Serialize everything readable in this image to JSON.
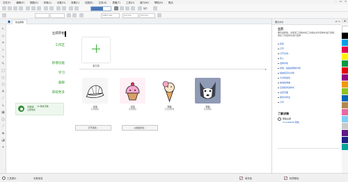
{
  "menubar": {
    "items": [
      "文件(F)",
      "编辑(E)",
      "视图(V)",
      "布局(L)",
      "对象(O)",
      "效果(C)",
      "位图(B)",
      "文本(X)",
      "表格(T)",
      "工具(O)",
      "窗口(W)",
      "帮助(H)",
      "购买"
    ],
    "controls": {
      "minimize": "–",
      "restore": "▭",
      "close": "×"
    }
  },
  "toolbar": {
    "snap_label": "贴齐",
    "field_x": "0.001 mm",
    "field_w1": "5.0 mm",
    "field_w2": "5.0 mm",
    "field_unit": "mm"
  },
  "document_tab": {
    "label": "欢迎屏幕"
  },
  "welcome": {
    "nav": {
      "items": [
        "立即开始",
        "工作区",
        "新增功能",
        "学习",
        "画廊",
        "获取更多"
      ],
      "active_index": 0
    },
    "promo": {
      "line1": "试用版",
      "line2": "立即购买",
      "line3": "16 剩余天数"
    },
    "new_document": {
      "label": "新文档"
    },
    "templates": [
      {
        "name": "试用",
        "sub": "使用模板"
      },
      {
        "name": "试用",
        "sub": "使用模板"
      },
      {
        "name": "样板",
        "sub": "已使用模板"
      },
      {
        "name": "样板",
        "sub": "使用模板"
      }
    ],
    "buttons": {
      "open_other": "打开其他...",
      "templates_btn": "从模板新建..."
    }
  },
  "right_panel": {
    "title": "提示(N)",
    "section1_title": "主页",
    "section1_text": "要获得帮助，请使用工具箱中的工具或在文件菜单中进行选择，或在下列选项中进行选择：",
    "links": [
      "新建",
      "打开",
      "打开文档...",
      "导入",
      "选择对象",
      "复制、粘贴和删除对象",
      "缩放和定位对象",
      "为对象着色",
      "撤消和重做",
      "应用和修改样式",
      "设置页面",
      "保存并导出",
      "打印"
    ],
    "section2_title": "了解详情",
    "learn_item": "帮助主题",
    "learn_sub": "CorelDRAW 帮助"
  },
  "statusbar": {
    "left_label": "工具提示",
    "object_info": "对象信息",
    "fill_label": "填充色",
    "outline_label": "轮廓颜色"
  },
  "colors": {
    "accent_green": "#3cae3c",
    "link_blue": "#2a62c9",
    "palette": [
      "#ffffff",
      "#000000",
      "#00a0e9",
      "#e5004f",
      "#fff100",
      "#009944",
      "#e60012",
      "#920783",
      "#f39800",
      "#8fc31f",
      "#0068b7",
      "#b28850",
      "#ea68a2",
      "#7ecef4",
      "#c9caca",
      "#601986",
      "#1d2088",
      "#00a29a"
    ]
  }
}
